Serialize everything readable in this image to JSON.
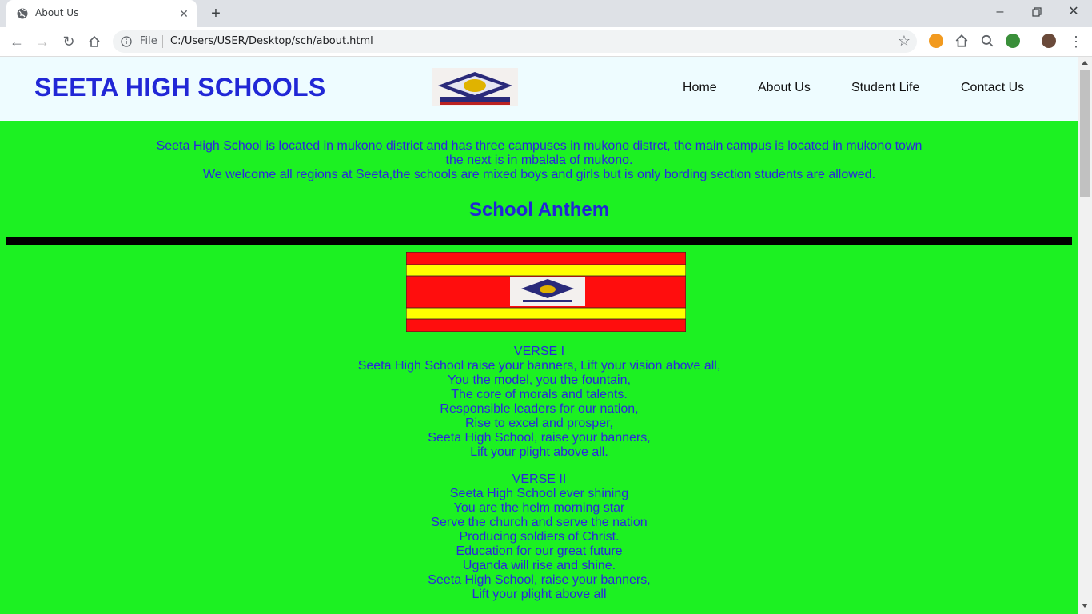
{
  "browser": {
    "tab_title": "About Us",
    "file_label": "File",
    "url": "C:/Users/USER/Desktop/sch/about.html"
  },
  "site": {
    "title": "SEETA HIGH SCHOOLS",
    "nav": [
      "Home",
      "About Us",
      "Student Life",
      "Contact Us"
    ]
  },
  "intro": [
    "Seeta High School is located in mukono district and has three campuses in mukono distrct, the main campus is located in mukono town",
    "the next is in mbalala of mukono.",
    "We welcome all regions at Seeta,the schools are mixed boys and girls but is only bording section students are allowed."
  ],
  "anthem_title": "School Anthem",
  "verses": [
    {
      "heading": "VERSE I",
      "lines": [
        "Seeta High School raise your banners, Lift your vision above all,",
        "You the model, you the fountain,",
        "The core of morals and talents.",
        "Responsible leaders for our nation,",
        "Rise to excel and prosper,",
        "Seeta High School, raise your banners,",
        "Lift your plight above all."
      ]
    },
    {
      "heading": "VERSE II",
      "lines": [
        "Seeta High School ever shining",
        "You are the helm morning star",
        "Serve the church and serve the nation",
        "Producing soldiers of Christ.",
        "Education for our great future",
        "Uganda will rise and shine.",
        "Seeta High School, raise your banners,",
        "Lift your plight above all"
      ]
    }
  ],
  "colors": {
    "page_bg": "#1cf122",
    "header_bg": "#eefcff",
    "text_blue": "#2a28dc",
    "flag_red": "#ff0d0d",
    "flag_yellow": "#ffff00"
  }
}
